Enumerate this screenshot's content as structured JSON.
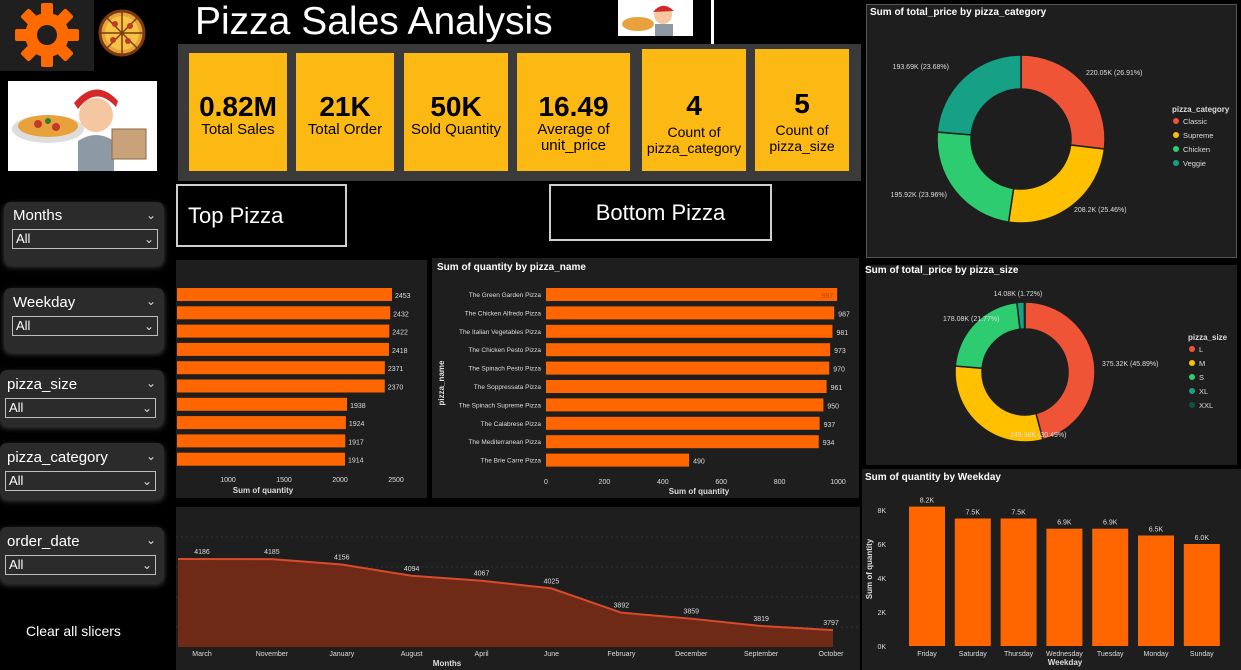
{
  "title": "Pizza Sales Analysis",
  "colors": {
    "kpi": "#fdb913",
    "bar": "#ff6600",
    "area_line": "#d94a2b",
    "area_fill": "#6e2a17",
    "classic": "#f05436",
    "supreme": "#ffc000",
    "chicken": "#2ecc71",
    "veggie": "#16a085"
  },
  "icons": {
    "settings": "gear-icon",
    "logo": "pizza-icon",
    "chef": "chef-image"
  },
  "kpis": [
    {
      "value": "0.82M",
      "label": "Total Sales"
    },
    {
      "value": "21K",
      "label": "Total Order"
    },
    {
      "value": "50K",
      "label": "Sold Quantity"
    },
    {
      "value": "16.49",
      "label1": "Average of",
      "label2": "unit_price"
    },
    {
      "value": "4",
      "label1": "Count of",
      "label2": "pizza_category"
    },
    {
      "value": "5",
      "label1": "Count of",
      "label2": "pizza_size"
    }
  ],
  "buttons": {
    "top": "Top Pizza",
    "bottom": "Bottom Pizza",
    "clear": "Clear all slicers"
  },
  "slicers": [
    {
      "label": "Months",
      "value": "All"
    },
    {
      "label": "Weekday",
      "value": "All"
    },
    {
      "label": "pizza_size",
      "value": "All"
    },
    {
      "label": "pizza_category",
      "value": "All"
    },
    {
      "label": "order_date",
      "value": "All"
    }
  ],
  "chart_data": [
    {
      "id": "top_pizza",
      "type": "bar",
      "orientation": "horizontal",
      "xlabel": "Sum of quantity",
      "xticks": [
        1000,
        1500,
        2000,
        2500
      ],
      "values": [
        2453,
        2432,
        2422,
        2418,
        2371,
        2370,
        1938,
        1924,
        1917,
        1914
      ]
    },
    {
      "id": "bottom_pizza",
      "type": "bar",
      "orientation": "horizontal",
      "title": "Sum of quantity by pizza_name",
      "xlabel": "Sum of quantity",
      "ylabel": "pizza_name",
      "xticks": [
        0,
        200,
        400,
        600,
        800,
        1000
      ],
      "categories": [
        "The Green Garden Pizza",
        "The Chicken Alfredo Pizza",
        "The Italian Vegetables Pizza",
        "The Chicken Pesto Pizza",
        "The Spinach Pesto Pizza",
        "The Soppressata Pizza",
        "The Spinach Supreme Pizza",
        "The Calabrese Pizza",
        "The Mediterranean Pizza",
        "The Brie Carre Pizza"
      ],
      "values": [
        997,
        987,
        981,
        973,
        970,
        961,
        950,
        937,
        934,
        490
      ]
    },
    {
      "id": "months",
      "type": "area",
      "xlabel": "Months",
      "categories": [
        "March",
        "November",
        "January",
        "August",
        "April",
        "June",
        "February",
        "December",
        "September",
        "October"
      ],
      "values": [
        4186,
        4185,
        4156,
        4094,
        4067,
        4025,
        3892,
        3859,
        3819,
        3797
      ]
    },
    {
      "id": "category_pie",
      "type": "pie",
      "title": "Sum of total_price by pizza_category",
      "legend_title": "pizza_category",
      "categories": [
        "Classic",
        "Supreme",
        "Chicken",
        "Veggie"
      ],
      "labels": [
        "220.05K (26.91%)",
        "208.2K (25.46%)",
        "195.92K (23.96%)",
        "193.69K (23.68%)"
      ],
      "values": [
        220.05,
        208.2,
        195.92,
        193.69
      ]
    },
    {
      "id": "size_pie",
      "type": "pie",
      "title": "Sum of total_price by pizza_size",
      "legend_title": "pizza_size",
      "categories": [
        "L",
        "M",
        "S",
        "XL",
        "XXL"
      ],
      "labels": [
        "375.32K (45.89%)",
        "249.38K (30.49%)",
        "178.08K (21.77%)",
        "14.08K (1.72%)",
        ""
      ],
      "values": [
        375.32,
        249.38,
        178.08,
        14.08,
        1.03
      ]
    },
    {
      "id": "weekday",
      "type": "bar",
      "title": "Sum of quantity by Weekday",
      "xlabel": "Weekday",
      "ylabel": "Sum of quantity",
      "yticks": [
        "0K",
        "2K",
        "4K",
        "6K",
        "8K"
      ],
      "ylim": [
        0,
        8800
      ],
      "categories": [
        "Friday",
        "Saturday",
        "Thursday",
        "Wednesday",
        "Tuesday",
        "Monday",
        "Sunday"
      ],
      "values": [
        8200,
        7500,
        7500,
        6900,
        6900,
        6500,
        6000
      ],
      "labels": [
        "8.2K",
        "7.5K",
        "7.5K",
        "6.9K",
        "6.9K",
        "6.5K",
        "6.0K"
      ]
    }
  ]
}
